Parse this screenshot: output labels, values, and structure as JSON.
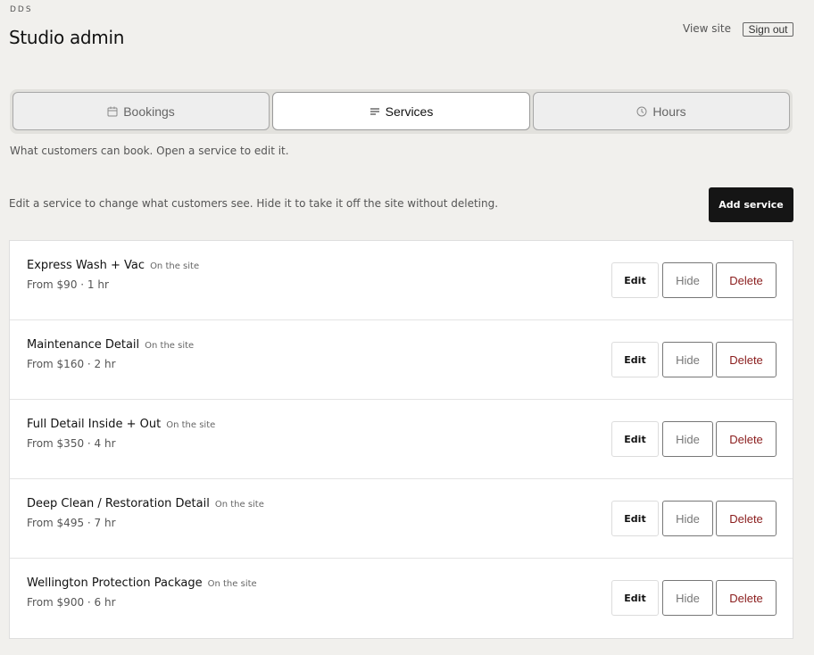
{
  "header": {
    "brand": "DDS",
    "title": "Studio admin",
    "view_site": "View site",
    "sign_out": "Sign out"
  },
  "tabs": [
    {
      "label": "Bookings",
      "icon": "calendar-icon",
      "active": false
    },
    {
      "label": "Services",
      "icon": "list-icon",
      "active": true
    },
    {
      "label": "Hours",
      "icon": "clock-icon",
      "active": false
    }
  ],
  "tab_note": "What customers can book. Open a service to edit it.",
  "help_text": "Edit a service to change what customers see. Hide it to take it off the site without deleting.",
  "add_service_label": "Add service",
  "services": [
    {
      "name": "Express Wash + Vac",
      "status": "On the site",
      "meta": "From $90 · 1 hr"
    },
    {
      "name": "Maintenance Detail",
      "status": "On the site",
      "meta": "From $160 · 2 hr"
    },
    {
      "name": "Full Detail Inside + Out",
      "status": "On the site",
      "meta": "From $350 · 4 hr"
    },
    {
      "name": "Deep Clean / Restoration Detail",
      "status": "On the site",
      "meta": "From $495 · 7 hr"
    },
    {
      "name": "Wellington Protection Package",
      "status": "On the site",
      "meta": "From $900 · 6 hr"
    }
  ],
  "row_actions": {
    "edit": "Edit",
    "hide": "Hide",
    "delete": "Delete"
  },
  "colors": {
    "background": "#f1f0ed",
    "primary_button": "#151515",
    "delete_text": "#8a1c1c"
  }
}
